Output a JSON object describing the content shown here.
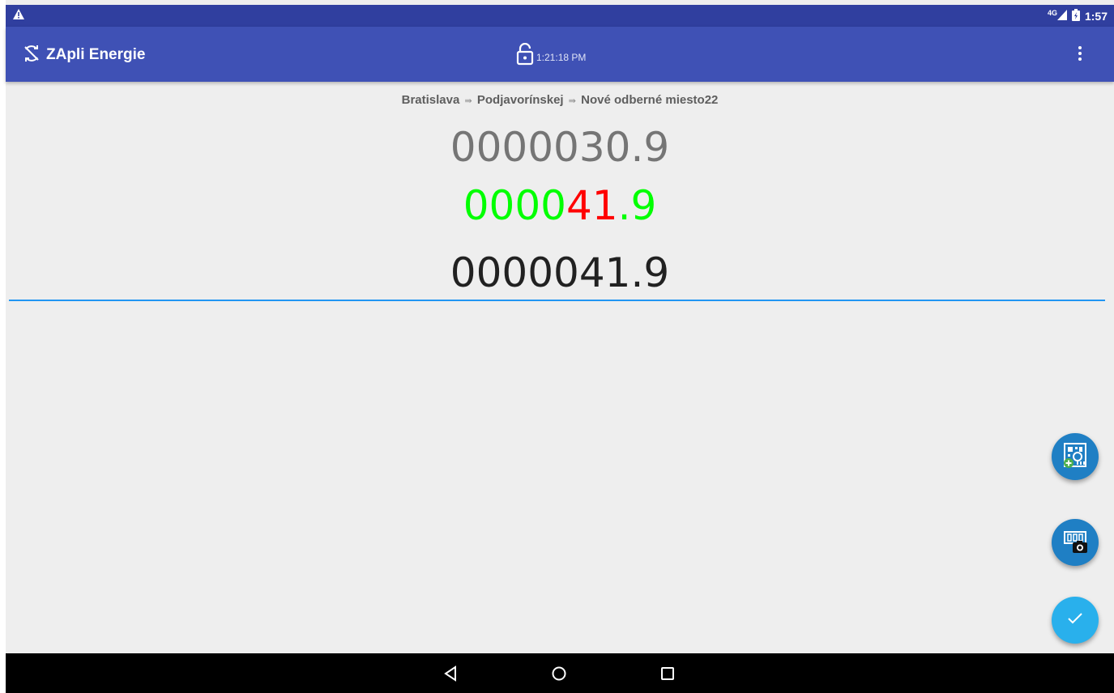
{
  "status_bar": {
    "warning_icon": "warning-triangle-icon",
    "network": "4G",
    "time": "1:57"
  },
  "app_bar": {
    "sync_icon": "sync-disabled-icon",
    "title": "ZApli Energie",
    "lock_icon": "lock-open-icon",
    "lock_time": "1:21:18 PM",
    "menu_icon": "more-vert-icon"
  },
  "breadcrumb": {
    "city": "Bratislava",
    "separator": "⇛",
    "street": "Podjavorínskej",
    "place": "Nové odberné miesto22"
  },
  "readings": {
    "previous": "0000030.9",
    "current_prefix": "0000",
    "current_highlight": "41",
    "current_suffix": ".9",
    "input_value": "0000041.9"
  },
  "colors": {
    "status_bar": "#303f9f",
    "app_bar": "#3f51b5",
    "reading_current": "#00ff00",
    "reading_changed": "#ff0000",
    "input_underline": "#2196f3",
    "fab_confirm": "#29b0ec"
  },
  "fabs": [
    "add-meter-icon",
    "camera-scan-icon",
    "check-icon"
  ],
  "nav_bar": [
    "back-icon",
    "home-icon",
    "recent-apps-icon"
  ]
}
